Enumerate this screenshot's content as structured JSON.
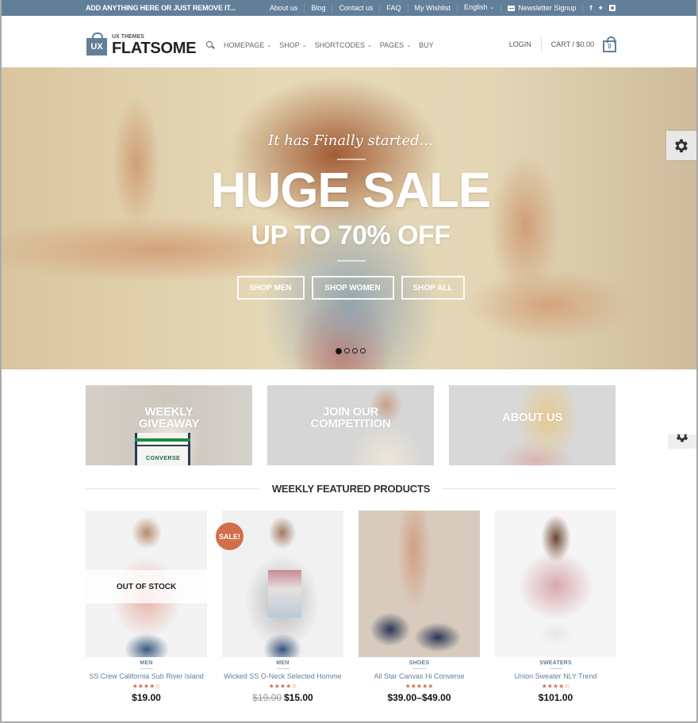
{
  "topbar": {
    "promo": "ADD ANYTHING HERE OR JUST REMOVE IT...",
    "links": [
      "About us",
      "Blog",
      "Contact us",
      "FAQ",
      "My Wishlist"
    ],
    "language": "English",
    "newsletter": "Newsletter Signup",
    "social": {
      "facebook": "f",
      "twitter": "t",
      "instagram": "i"
    }
  },
  "header": {
    "logo_badge": "UX",
    "logo_small": "UX THEMES",
    "logo_brand": "FLATSOME",
    "nav": [
      "HOMEPAGE",
      "SHOP",
      "SHORTCODES",
      "PAGES",
      "BUY"
    ],
    "login": "LOGIN",
    "cart": "CART / $0.00",
    "cart_count": "0"
  },
  "hero": {
    "tagline": "It has Finally started...",
    "title": "HUGE SALE",
    "subtitle": "UP TO 70% OFF",
    "buttons": [
      "SHOP MEN",
      "SHOP WOMEN",
      "SHOP ALL"
    ],
    "slides": 4,
    "active_slide": 1
  },
  "banners": [
    {
      "label_line1": "WEEKLY",
      "label_line2": "GIVEAWAY",
      "print": "CONVERSE"
    },
    {
      "label_line1": "JOIN OUR",
      "label_line2": "COMPETITION"
    },
    {
      "label_line1": "ABOUT US",
      "label_line2": ""
    }
  ],
  "featured": {
    "title": "WEEKLY FEATURED PRODUCTS",
    "products": [
      {
        "category": "MEN",
        "name": "SS Crew California Sub River Island",
        "rating": 4,
        "price": "$19.00",
        "old_price": "",
        "badge": "",
        "overlay": "OUT OF STOCK"
      },
      {
        "category": "MEN",
        "name": "Wicked SS O-Neck Selected Homme",
        "rating": 4,
        "price": "$15.00",
        "old_price": "$19.00",
        "badge": "SALE!",
        "overlay": ""
      },
      {
        "category": "SHOES",
        "name": "All Star Canvas Hi Converse",
        "rating": 5,
        "price": "$39.00–$49.00",
        "old_price": "",
        "badge": "",
        "overlay": ""
      },
      {
        "category": "SWEATERS",
        "name": "Union Sweater NLY Trend",
        "rating": 4,
        "price": "$101.00",
        "old_price": "",
        "badge": "",
        "overlay": ""
      }
    ]
  },
  "colors": {
    "primary": "#627f9a",
    "accent": "#d26e4b"
  }
}
